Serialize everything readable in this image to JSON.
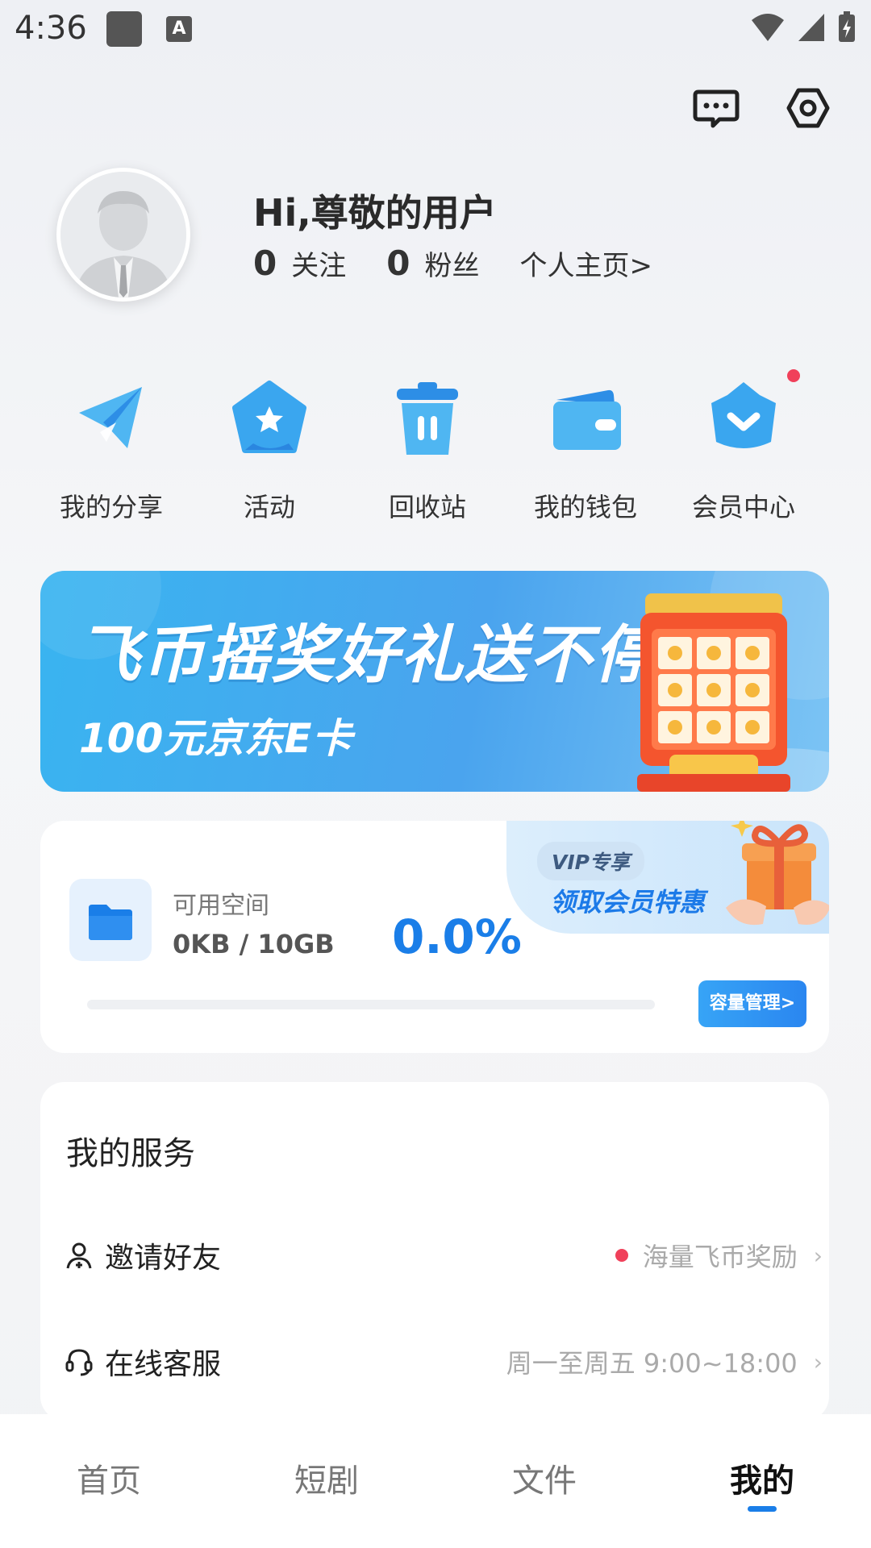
{
  "status_bar": {
    "time": "4:36",
    "a_icon_label": "A"
  },
  "header": {
    "message_icon": "message-icon",
    "settings_icon": "settings-hex-icon"
  },
  "profile": {
    "greeting": "Hi,尊敬的用户",
    "follow_count": "0",
    "follow_label": "关注",
    "fans_count": "0",
    "fans_label": "粉丝",
    "homepage_link": "个人主页>"
  },
  "quick_entries": [
    {
      "label": "我的分享",
      "icon": "paper-plane-icon"
    },
    {
      "label": "活动",
      "icon": "star-badge-icon"
    },
    {
      "label": "回收站",
      "icon": "trash-bin-icon"
    },
    {
      "label": "我的钱包",
      "icon": "wallet-icon"
    },
    {
      "label": "会员中心",
      "icon": "crown-icon",
      "has_badge": true
    }
  ],
  "banner": {
    "title": "飞币摇奖好礼送不停",
    "subtitle": "100元京东E卡"
  },
  "storage": {
    "label": "可用空间",
    "usage": "0KB / 10GB",
    "percent_text": "0.0%",
    "progress_fraction": 0.0,
    "manage_button": "容量管理>",
    "vip_pill": "VIP专享",
    "vip_offer": "领取会员特惠"
  },
  "services": {
    "title": "我的服务",
    "items": [
      {
        "label": "邀请好友",
        "icon": "person-add-icon",
        "right_text": "海量飞币奖励",
        "has_dot": true
      },
      {
        "label": "在线客服",
        "icon": "headset-icon",
        "right_text": "周一至周五 9:00~18:00",
        "has_dot": false
      }
    ]
  },
  "bottom_nav": {
    "items": [
      {
        "label": "首页",
        "active": false
      },
      {
        "label": "短剧",
        "active": false
      },
      {
        "label": "文件",
        "active": false
      },
      {
        "label": "我的",
        "active": true
      }
    ]
  },
  "colors": {
    "accent": "#1a7ee8",
    "badge_red": "#f0405a",
    "banner_blue": "#39b4f0"
  }
}
